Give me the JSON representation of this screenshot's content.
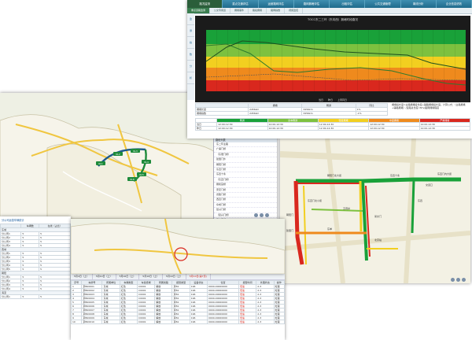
{
  "nav": {
    "items": [
      {
        "label": "路况监测"
      },
      {
        "label": "重点交通评估"
      },
      {
        "label": "运营路网评估"
      },
      {
        "label": "路网拥堵评估"
      },
      {
        "label": "出租评估"
      },
      {
        "label": "公共交通管理"
      },
      {
        "label": "离线分析"
      },
      {
        "label": "企业信息绩效"
      }
    ]
  },
  "subtabs": [
    "重点道路监测",
    "公交专用道",
    "拥堵事件",
    "路段拥堵",
    "路网指数",
    "视频监控"
  ],
  "chart_title": "TOCC东二三环（东向西）拥堵时段路况",
  "side_tabs": [
    "监",
    "测",
    "指",
    "数",
    "分",
    "析"
  ],
  "colors": {
    "green": "#19a139",
    "lightgreen": "#7dc13f",
    "yellow": "#f2cf20",
    "orange": "#ef8a1d",
    "red": "#d9281e",
    "darkred": "#9a1c16"
  },
  "chart_legend": [
    "当日",
    "昨日",
    "上周同日"
  ],
  "stats": {
    "headers": [
      "",
      "拥堵",
      "畅通",
      "同比"
    ],
    "rows": [
      {
        "label": "拥堵长度",
        "v1": "2456km",
        "v2": "3456km",
        "v3": "1%"
      },
      {
        "label": "拥堵指数",
        "v1": "2456km",
        "v2": "3456km",
        "v3": "-1%"
      }
    ],
    "note": "拥堵段长度=主路拥堵段长度+辅路拥堵段长度。计算公式：（主路拥堵+辅路拥堵）/道路总长度=N%/路网拥堵程度",
    "level_headers": [
      "畅通",
      "基本畅通",
      "轻度拥堵",
      "中度拥堵",
      "严重拥堵"
    ],
    "level_rows": [
      {
        "label": "当日",
        "cells": [
          "12:00-12:30",
          "12:00-12:30",
          "12:00-12:30",
          "12:00-12:30",
          "12:00-12:30"
        ]
      },
      {
        "label": "昨日",
        "cells": [
          "12:00-12:30",
          "12:00-12:30",
          "12:00-12:30",
          "12:00-12:30",
          "12:00-12:30"
        ]
      }
    ]
  },
  "map1_labels": [
    "KL1",
    "KL2",
    "KL3",
    "KL4",
    "KL5",
    "KL6"
  ],
  "map1_list": {
    "title": "路段列表",
    "items": [
      "东二环主路",
      "广渠门桥",
      "（东便门桥）",
      "建国门外",
      "朝阳门桥",
      "东直门桥",
      "东四十条",
      "（东直门桥）",
      "雍和宫桥",
      "安定门桥",
      "德胜门桥",
      "西直门桥",
      "阜成门桥",
      "复兴门桥",
      "（复兴门桥）",
      "天宁寺桥",
      "右安门桥"
    ]
  },
  "left_panel": {
    "title": "分公司运营车辆统计",
    "col1": "车辆数",
    "col2": "在线（占比）",
    "groups": [
      {
        "label": "东城",
        "rows": [
          {
            "name": "分公司1",
            "a": "5",
            "b": "5"
          },
          {
            "name": "分公司2",
            "a": "5",
            "b": "5"
          },
          {
            "name": "分公司3",
            "a": "5",
            "b": "5"
          },
          {
            "name": "分公司4",
            "a": "5",
            "b": "5"
          }
        ]
      },
      {
        "label": "西城",
        "rows": [
          {
            "name": "分公司1",
            "a": "5",
            "b": "5"
          },
          {
            "name": "分公司2",
            "a": "5",
            "b": "5"
          },
          {
            "name": "分公司3",
            "a": "5",
            "b": "5"
          },
          {
            "name": "分公司4",
            "a": "5",
            "b": "5"
          },
          {
            "name": "分公司5",
            "a": "5",
            "b": "5"
          }
        ]
      },
      {
        "label": "朝阳",
        "rows": [
          {
            "name": "分公司1",
            "a": "5",
            "b": "5"
          },
          {
            "name": "分公司2",
            "a": "5",
            "b": "5"
          },
          {
            "name": "分公司3",
            "a": "5",
            "b": "5"
          },
          {
            "name": "分公司4",
            "a": "5",
            "b": "5"
          }
        ]
      },
      {
        "label": "海淀",
        "rows": [
          {
            "name": "分公司1",
            "a": "5",
            "b": "5"
          }
        ]
      }
    ]
  },
  "bottom_tabs": [
    "5月4日（上）",
    "5月10日（上）",
    "5月10日（上）",
    "5月10日（上）",
    "5月10日（上）",
    "5月10日(第7页)"
  ],
  "grid": {
    "headers": [
      "序号",
      "车牌号",
      "所属单位",
      "车辆类型",
      "车载终端",
      "所属线路",
      "报警类型",
      "设备状态",
      "位置",
      "报警时间",
      "处理状态",
      "操作"
    ],
    "rows": [
      [
        "1",
        "京B00001",
        "东城",
        "红色",
        "C0001",
        "解放",
        "京B1",
        "196",
        "0000-00000000",
        "低速",
        "2-3",
        "处理"
      ],
      [
        "2",
        "京B00002",
        "东城",
        "红色",
        "C0001",
        "解放",
        "京B1",
        "196",
        "0000-00000000",
        "低速",
        "2-3",
        "处理"
      ],
      [
        "3",
        "京B00003",
        "东城",
        "红色",
        "C0001",
        "解放",
        "京B1",
        "196",
        "0000-00000000",
        "低速",
        "2-3",
        "处理"
      ],
      [
        "4",
        "京B00004",
        "东城",
        "红色",
        "C0001",
        "解放",
        "京B1",
        "196",
        "0000-00000000",
        "低速",
        "2-3",
        "处理"
      ],
      [
        "5",
        "京B00005",
        "东城",
        "红色",
        "C0001",
        "解放",
        "京B1",
        "196",
        "0000-00000000",
        "低速",
        "2-3",
        "处理"
      ],
      [
        "6",
        "京B00006",
        "东城",
        "红色",
        "C0001",
        "解放",
        "京B1",
        "196",
        "0000-00000000",
        "低速",
        "2-3",
        "处理"
      ],
      [
        "7",
        "京B00007",
        "东城",
        "红色",
        "C0001",
        "解放",
        "京B1",
        "196",
        "0000-00000000",
        "低速",
        "2-3",
        "处理"
      ],
      [
        "8",
        "京B00008",
        "东城",
        "红色",
        "C0001",
        "解放",
        "京B1",
        "196",
        "0000-00000000",
        "低速",
        "2-3",
        "处理"
      ],
      [
        "9",
        "京B00009",
        "东城",
        "红色",
        "C0001",
        "解放",
        "京B1",
        "196",
        "0000-00000000",
        "低速",
        "2-3",
        "处理"
      ],
      [
        "10",
        "京B00010",
        "东城",
        "红色",
        "C0001",
        "解放",
        "京B1",
        "196",
        "0000-00000000",
        "低速",
        "2-3",
        "处理"
      ]
    ]
  },
  "traffic_labels": [
    "朝阳门北大街",
    "东四十条",
    "东直门内大街",
    "东直门北小街",
    "朝阳门",
    "建国门",
    "东单",
    "王府井",
    "崇文门",
    "北京站",
    "东四",
    "交道口"
  ]
}
